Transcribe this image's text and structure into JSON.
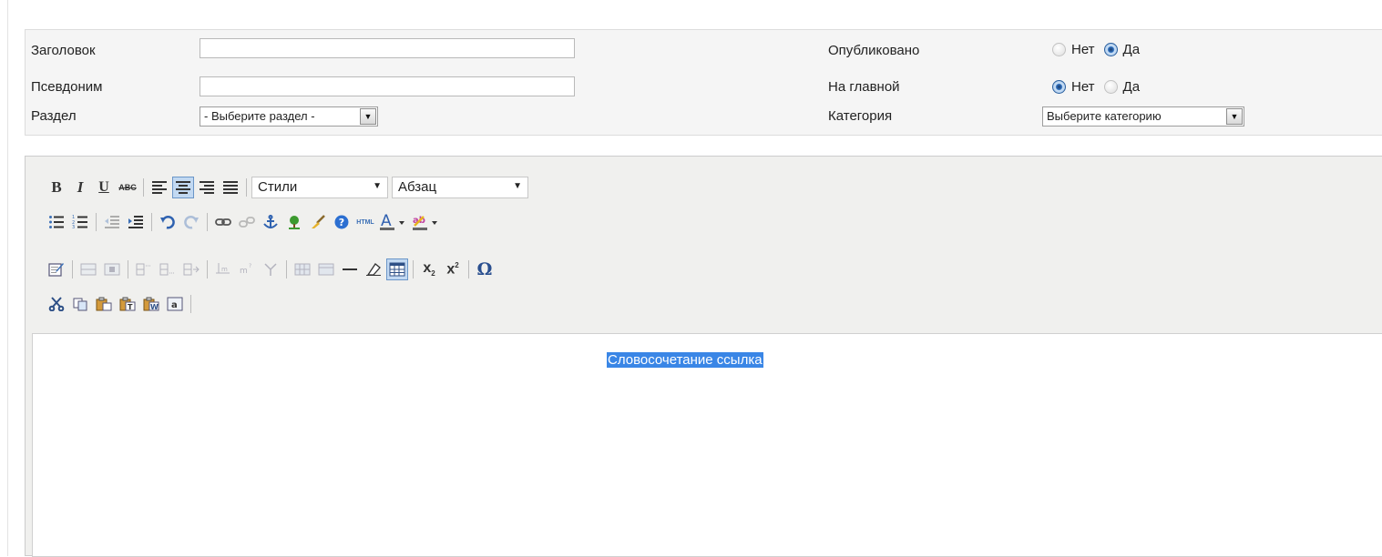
{
  "form": {
    "title_label": "Заголовок",
    "title_value": "",
    "alias_label": "Псевдоним",
    "alias_value": "",
    "section_label": "Раздел",
    "section_selected": "- Выберите раздел -",
    "published_label": "Опубликовано",
    "published_no": "Нет",
    "published_yes": "Да",
    "published_value": "Да",
    "frontpage_label": "На главной",
    "frontpage_no": "Нет",
    "frontpage_yes": "Да",
    "frontpage_value": "Нет",
    "category_label": "Категория",
    "category_selected": "Выберите категорию"
  },
  "editor": {
    "styles_select": "Стили",
    "format_select": "Абзац",
    "content_text": "Словосочетание ссылка",
    "icons": {
      "row1": [
        "bold-icon",
        "italic-icon",
        "underline-icon",
        "strikethrough-icon",
        "align-left-icon",
        "align-center-icon",
        "align-right-icon",
        "align-justify-icon"
      ],
      "row2": [
        "bullet-list-icon",
        "numbered-list-icon",
        "outdent-icon",
        "indent-icon",
        "undo-icon",
        "redo-icon",
        "link-icon",
        "unlink-icon",
        "anchor-icon",
        "image-icon",
        "cleanup-icon",
        "help-icon",
        "html-icon",
        "text-color-icon",
        "highlight-color-icon"
      ],
      "row3": [
        "edit-icon",
        "table-row-props-icon",
        "table-cell-props-icon",
        "insert-row-before-icon",
        "insert-row-after-icon",
        "delete-row-icon",
        "insert-col-before-icon",
        "insert-col-after-icon",
        "delete-col-icon",
        "split-cells-icon",
        "merge-cells-icon",
        "horizontal-rule-icon",
        "remove-format-icon",
        "table-icon",
        "subscript-icon",
        "superscript-icon",
        "special-char-icon"
      ],
      "row4": [
        "cut-icon",
        "copy-icon",
        "paste-icon",
        "paste-text-icon",
        "paste-word-icon",
        "select-all-icon"
      ]
    },
    "colors": {
      "selection": "#3a86e6",
      "toolbar_bg": "#f0f0ee",
      "active_button": "#c2d9f2"
    }
  }
}
